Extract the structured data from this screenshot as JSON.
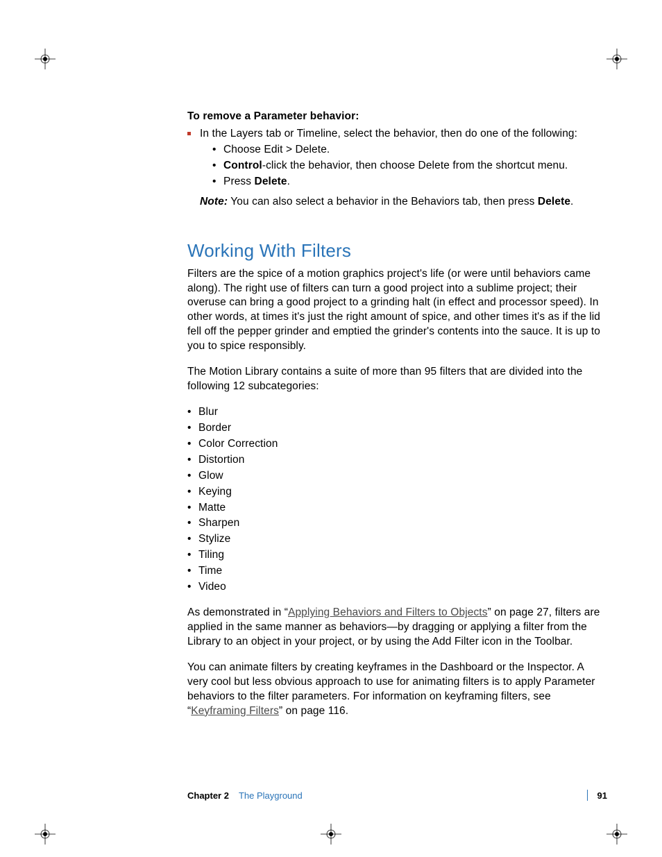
{
  "sectionA": {
    "heading": "To remove a Parameter behavior:",
    "step": "In the Layers tab or Timeline, select the behavior, then do one of the following:",
    "sub1": "Choose Edit > Delete.",
    "sub2_pre": "Control",
    "sub2_post": "-click the behavior, then choose Delete from the shortcut menu.",
    "sub3_pre": "Press ",
    "sub3_bold": "Delete",
    "sub3_post": ".",
    "note_label": "Note:",
    "note_pre": "  You can also select a behavior in the Behaviors tab, then press ",
    "note_bold": "Delete",
    "note_post": "."
  },
  "sectionB": {
    "heading": "Working With Filters",
    "p1": "Filters are the spice of a motion graphics project's life (or were until behaviors came along). The right use of filters can turn a good project into a sublime project; their overuse can bring a good project to a grinding halt (in effect and processor speed). In other words, at times it's just the right amount of spice, and other times it's as if the lid fell off the pepper grinder and emptied the grinder's contents into the sauce. It is up to you to spice responsibly.",
    "p2": "The Motion Library contains a suite of more than 95 filters that are divided into the following 12 subcategories:",
    "categories": [
      "Blur",
      "Border",
      "Color Correction",
      "Distortion",
      "Glow",
      "Keying",
      "Matte",
      "Sharpen",
      "Stylize",
      "Tiling",
      "Time",
      "Video"
    ],
    "p3_pre": "As demonstrated in “",
    "p3_link": "Applying Behaviors and Filters to Objects",
    "p3_post": "” on page 27, filters are applied in the same manner as behaviors—by dragging or applying a filter from the Library to an object in your project, or by using the Add Filter icon in the Toolbar.",
    "p4_pre": "You can animate filters by creating keyframes in the Dashboard or the Inspector. A very cool but less obvious approach to use for animating filters is to apply Parameter behaviors to the filter parameters. For information on keyframing filters, see “",
    "p4_link": "Keyframing Filters",
    "p4_post": "” on page 116."
  },
  "footer": {
    "chapter_label": "Chapter 2",
    "chapter_title": "The Playground",
    "page": "91"
  }
}
